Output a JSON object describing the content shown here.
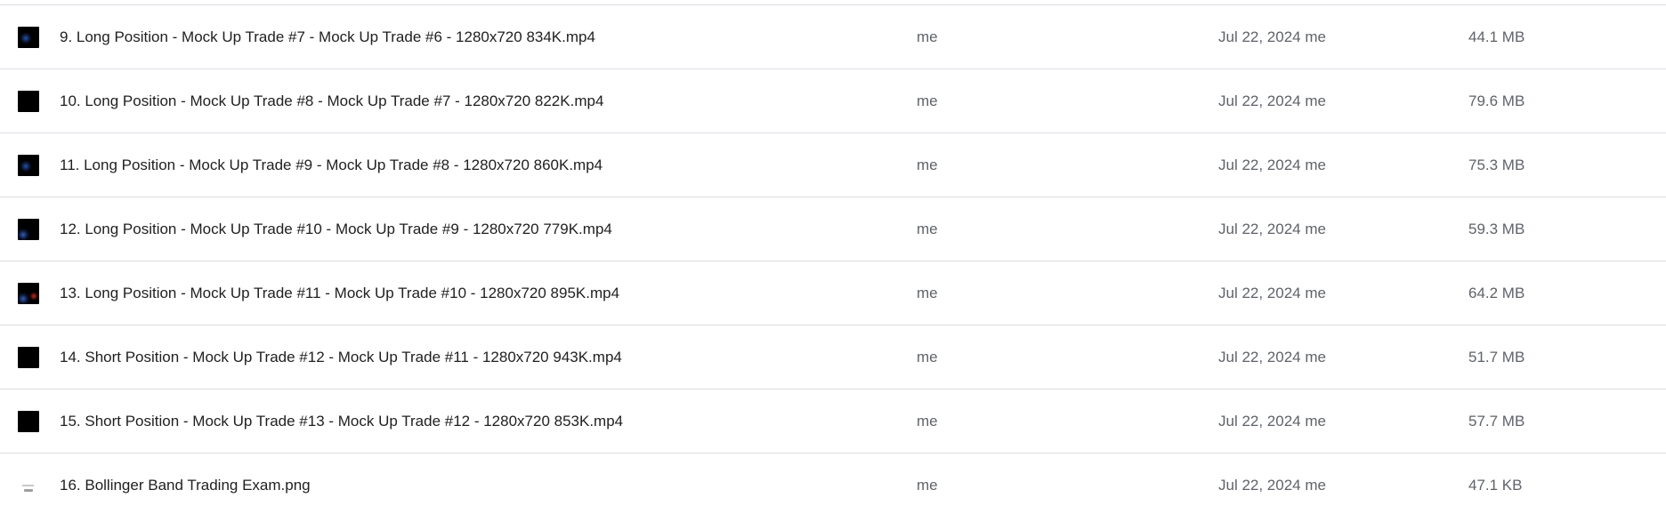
{
  "files": [
    {
      "name": "9. Long Position - Mock Up Trade #7 - Mock Up Trade #6 - 1280x720 834K.mp4",
      "owner": "me",
      "modified": "Jul 22, 2024 me",
      "size": "44.1 MB",
      "thumbnail": "video-thumbnail"
    },
    {
      "name": "10. Long Position - Mock Up Trade #8 - Mock Up Trade #7 - 1280x720 822K.mp4",
      "owner": "me",
      "modified": "Jul 22, 2024 me",
      "size": "79.6 MB",
      "thumbnail": "video-thumbnail"
    },
    {
      "name": "11. Long Position - Mock Up Trade #9 - Mock Up Trade #8 - 1280x720 860K.mp4",
      "owner": "me",
      "modified": "Jul 22, 2024 me",
      "size": "75.3 MB",
      "thumbnail": "video-thumbnail"
    },
    {
      "name": "12. Long Position - Mock Up Trade #10 - Mock Up Trade #9 - 1280x720 779K.mp4",
      "owner": "me",
      "modified": "Jul 22, 2024 me",
      "size": "59.3 MB",
      "thumbnail": "video-thumbnail"
    },
    {
      "name": "13. Long Position - Mock Up Trade #11 - Mock Up Trade #10 - 1280x720 895K.mp4",
      "owner": "me",
      "modified": "Jul 22, 2024 me",
      "size": "64.2 MB",
      "thumbnail": "video-thumbnail"
    },
    {
      "name": "14. Short Position - Mock Up Trade #12 - Mock Up Trade #11 - 1280x720 943K.mp4",
      "owner": "me",
      "modified": "Jul 22, 2024 me",
      "size": "51.7 MB",
      "thumbnail": "video-thumbnail"
    },
    {
      "name": "15. Short Position - Mock Up Trade #13 - Mock Up Trade #12 - 1280x720 853K.mp4",
      "owner": "me",
      "modified": "Jul 22, 2024 me",
      "size": "57.7 MB",
      "thumbnail": "video-thumbnail"
    },
    {
      "name": "16. Bollinger Band Trading Exam.png",
      "owner": "me",
      "modified": "Jul 22, 2024 me",
      "size": "47.1 KB",
      "thumbnail": "image-thumbnail"
    }
  ]
}
